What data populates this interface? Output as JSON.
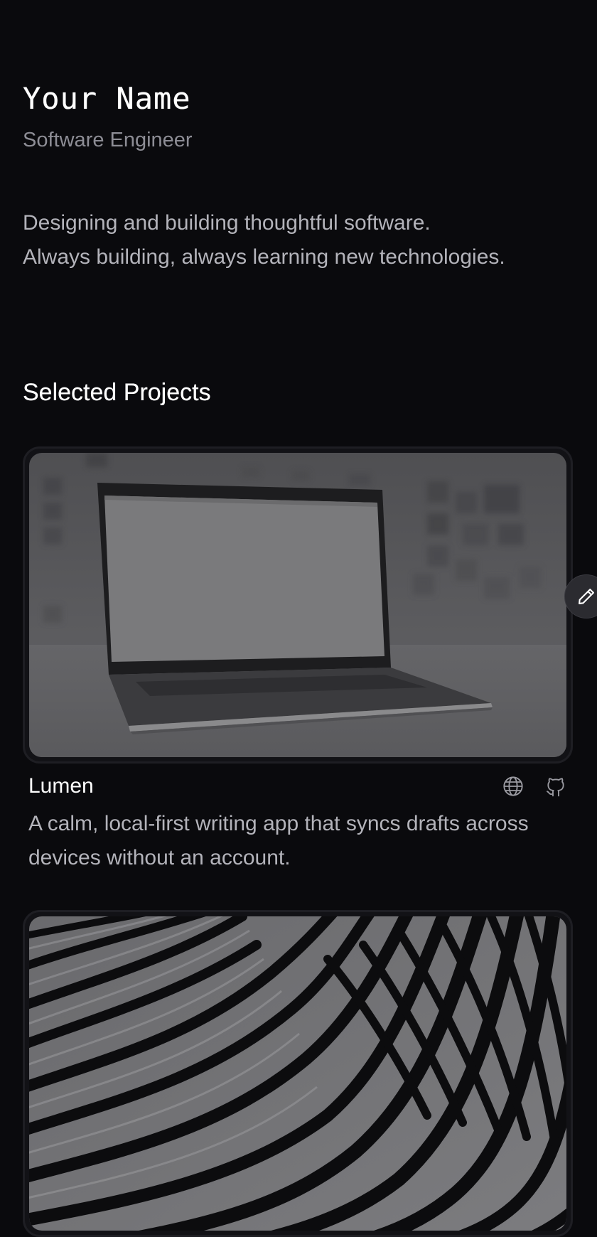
{
  "profile": {
    "name": "Your Name",
    "role": "Software Engineer",
    "intro": [
      "Designing and building thoughtful software.",
      "Always building, always learning new technologies."
    ]
  },
  "projects_section": {
    "heading": "Selected Projects",
    "projects": [
      {
        "title": "Lumen",
        "description": "A calm, local-first writing app that syncs drafts across devices without an account.",
        "image_icon": "laptop-photo",
        "links": [
          "globe-icon",
          "github-icon"
        ]
      },
      {
        "title": "",
        "description": "",
        "image_icon": "wavy-abstract-photo"
      }
    ]
  },
  "actions": {
    "edit_icon": "pencil-icon"
  },
  "colors": {
    "background": "#0a0a0d",
    "card_border": "#1e1e23",
    "muted_text": "#8d8d95",
    "body_text": "#b3b3ba"
  }
}
